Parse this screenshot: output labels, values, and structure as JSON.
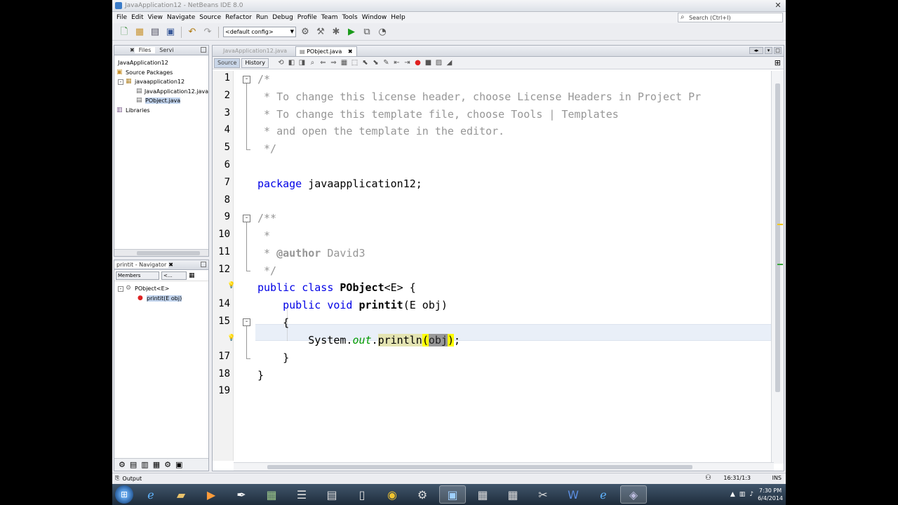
{
  "window": {
    "title": "JavaApplication12 - NetBeans IDE 8.0"
  },
  "menu": [
    "File",
    "Edit",
    "View",
    "Navigate",
    "Source",
    "Refactor",
    "Run",
    "Debug",
    "Profile",
    "Team",
    "Tools",
    "Window",
    "Help"
  ],
  "search": {
    "placeholder": "Search (Ctrl+I)"
  },
  "toolbar": {
    "config": "<default config>"
  },
  "projects": {
    "tabs": [
      "Files",
      "Servi"
    ],
    "tree": [
      {
        "label": "JavaApplication12",
        "indent": 0,
        "icon": "project-icon"
      },
      {
        "label": "Source Packages",
        "indent": 0,
        "icon": "folder-icon"
      },
      {
        "label": "javaapplication12",
        "indent": 1,
        "icon": "package-icon",
        "toggle": "-"
      },
      {
        "label": "JavaApplication12.java",
        "indent": 2,
        "icon": "java-file-icon"
      },
      {
        "label": "PObject.java",
        "indent": 2,
        "icon": "java-file-icon",
        "selected": true
      },
      {
        "label": "Libraries",
        "indent": 0,
        "icon": "library-icon"
      }
    ]
  },
  "navigator": {
    "title": "printit - Navigator",
    "filter": "Members",
    "filter2": "<...",
    "tree": [
      {
        "label": "PObject<E>",
        "indent": 0,
        "icon": "class-icon",
        "toggle": "-"
      },
      {
        "label": "printit(E obj)",
        "indent": 1,
        "icon": "method-icon",
        "selected": true
      }
    ]
  },
  "editor": {
    "tabs": [
      {
        "label": "JavaApplication12.java",
        "active": false
      },
      {
        "label": "PObject.java",
        "active": true
      }
    ],
    "modes": {
      "source": "Source",
      "history": "History"
    },
    "lines": {
      "l1": "/*",
      "l2": " * To change this license header, choose License Headers in Project Pr",
      "l3": " * To change this template file, choose Tools | Templates",
      "l4": " * and open the template in the editor.",
      "l5": " */",
      "l7a": "package",
      "l7b": " javaapplication12;",
      "l9": "/**",
      "l10": " *",
      "l11a": " * ",
      "l11b": "@author",
      "l11c": " David3",
      "l12": " */",
      "l13a": "public class",
      "l13b": " PObject",
      "l13c": "<E> {",
      "l14a": "    public void",
      "l14b": " printit",
      "l14c": "(E obj)",
      "l15": "    {",
      "l16a": "        System.",
      "l16b": "out",
      "l16c": ".",
      "l16d": "println",
      "l16e": "(",
      "l16f": "obj",
      "l16g": ")",
      "l16h": ";",
      "l17": "    }",
      "l18": "}"
    },
    "line_numbers": [
      "1",
      "2",
      "3",
      "4",
      "5",
      "6",
      "7",
      "8",
      "9",
      "10",
      "11",
      "12",
      "13",
      "14",
      "15",
      "16",
      "17",
      "18",
      "19"
    ]
  },
  "status": {
    "output": "Output",
    "position": "16:31/1:3",
    "mode": "INS"
  },
  "taskbar": {
    "time": "7:30 PM",
    "date": "6/4/2014"
  },
  "colors": {
    "keyword": "#0000e6",
    "comment": "#969696",
    "field": "#009900",
    "highlight": "#ffff00"
  }
}
